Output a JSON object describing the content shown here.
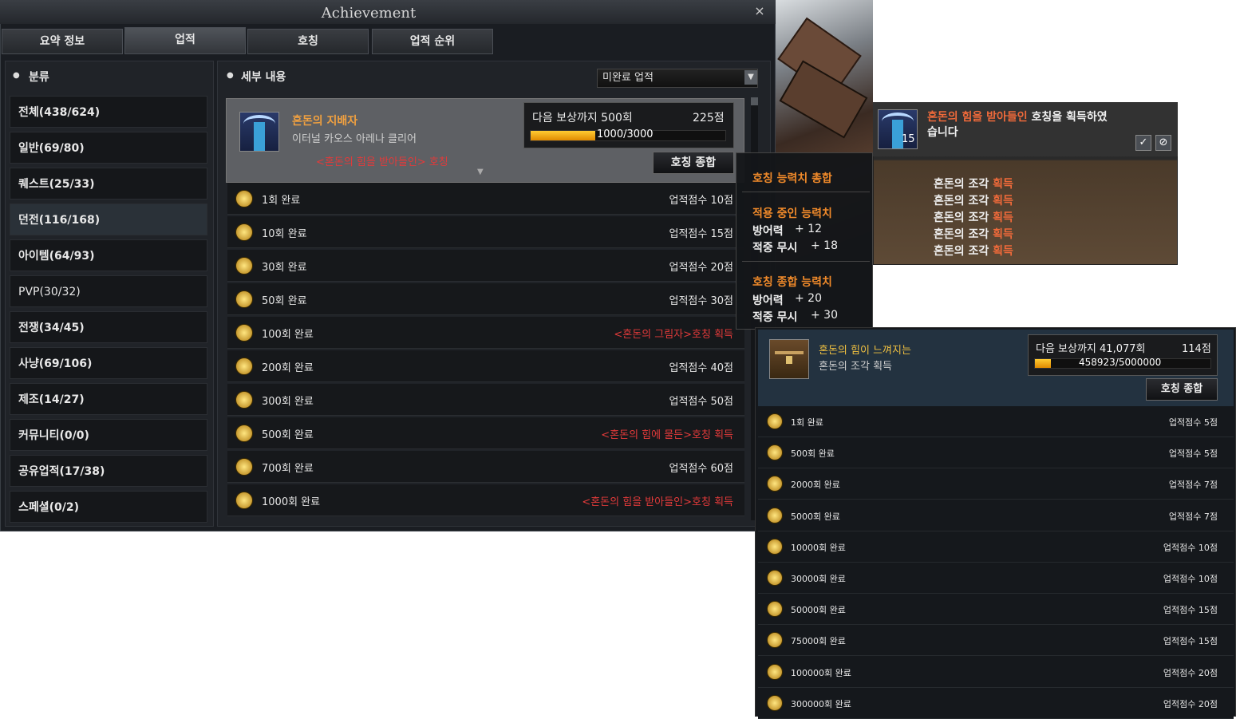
{
  "window": {
    "title": "Achievement",
    "close_icon": "close-icon",
    "tabs": [
      {
        "label": "요약 정보"
      },
      {
        "label": "업적"
      },
      {
        "label": "호칭"
      },
      {
        "label": "업적 순위"
      }
    ]
  },
  "categories": {
    "header": "분류",
    "items": [
      {
        "label": "전체(438/624)"
      },
      {
        "label": "일반(69/80)"
      },
      {
        "label": "퀘스트(25/33)"
      },
      {
        "label": "던전(116/168)"
      },
      {
        "label": "아이템(64/93)"
      },
      {
        "label": "PVP(30/32)"
      },
      {
        "label": "전쟁(34/45)"
      },
      {
        "label": "사냥(69/106)"
      },
      {
        "label": "제조(14/27)"
      },
      {
        "label": "커뮤니티(0/0)"
      },
      {
        "label": "공유업적(17/38)"
      },
      {
        "label": "스페셜(0/2)"
      }
    ]
  },
  "details": {
    "header": "세부 내용",
    "filter_value": "미완료 업적",
    "card": {
      "name": "혼돈의 지배자",
      "desc": "이터널 카오스 아레나 클리어",
      "reward": "<혼돈의 힘을 받아들인> 호칭",
      "next_label": "다음 보상까지 500회",
      "points": "225점",
      "progress_text": "1000/3000",
      "progress_fraction": 0.333,
      "title_summary_button": "호칭 종합"
    },
    "rows": [
      {
        "label": "1회 완료",
        "reward": "업적점수 10점",
        "special": false
      },
      {
        "label": "10회 완료",
        "reward": "업적점수 15점",
        "special": false
      },
      {
        "label": "30회 완료",
        "reward": "업적점수 20점",
        "special": false
      },
      {
        "label": "50회 완료",
        "reward": "업적점수 30점",
        "special": false
      },
      {
        "label": "100회 완료",
        "reward": "<혼돈의 그림자>호칭 획득",
        "special": true
      },
      {
        "label": "200회 완료",
        "reward": "업적점수 40점",
        "special": false
      },
      {
        "label": "300회 완료",
        "reward": "업적점수 50점",
        "special": false
      },
      {
        "label": "500회 완료",
        "reward": "<혼돈의 힘에 물든>호칭 획득",
        "special": true
      },
      {
        "label": "700회 완료",
        "reward": "업적점수 60점",
        "special": false
      },
      {
        "label": "1000회 완료",
        "reward": "<혼돈의 힘을 받아들인>호칭 획득",
        "special": true
      }
    ]
  },
  "tooltip": {
    "title": "호칭 능력치 총합",
    "applied_header": "적용 중인 능력치",
    "applied": [
      {
        "name": "방어력",
        "value": "+ 12"
      },
      {
        "name": "적중 무시",
        "value": "+ 18"
      }
    ],
    "total_header": "호칭 종합 능력치",
    "total": [
      {
        "name": "방어력",
        "value": "+ 20"
      },
      {
        "name": "적중 무시",
        "value": "+ 30"
      }
    ]
  },
  "notification": {
    "highlight": "혼돈의 힘을 받아들인",
    "message_rest": " 호칭을 획득하였",
    "message_line2": "습니다",
    "icon_count": "15",
    "confirm_icon": "check-icon",
    "cancel_icon": "cancel-icon",
    "loot_item": "혼돈의 조각",
    "loot_verb": "획득",
    "loot_lines": 5
  },
  "second_panel": {
    "card": {
      "name": "혼돈의 힘이 느껴지는",
      "desc": "혼돈의 조각 획득",
      "next_label": "다음 보상까지 41,077회",
      "points": "114점",
      "progress_text": "458923/5000000",
      "progress_fraction": 0.092,
      "title_summary_button": "호칭 종합"
    },
    "rows": [
      {
        "label": "1회 완료",
        "reward": "업적점수 5점"
      },
      {
        "label": "500회 완료",
        "reward": "업적점수 5점"
      },
      {
        "label": "2000회 완료",
        "reward": "업적점수 7점"
      },
      {
        "label": "5000회 완료",
        "reward": "업적점수 7점"
      },
      {
        "label": "10000회 완료",
        "reward": "업적점수 10점"
      },
      {
        "label": "30000회 완료",
        "reward": "업적점수 10점"
      },
      {
        "label": "50000회 완료",
        "reward": "업적점수 15점"
      },
      {
        "label": "75000회 완료",
        "reward": "업적점수 15점"
      },
      {
        "label": "100000회 완료",
        "reward": "업적점수 20점"
      },
      {
        "label": "300000회 완료",
        "reward": "업적점수 20점"
      }
    ]
  },
  "colors": {
    "accent_orange": "#f0a040",
    "reward_red": "#e23a3a",
    "selected_card": "#5e6064"
  }
}
